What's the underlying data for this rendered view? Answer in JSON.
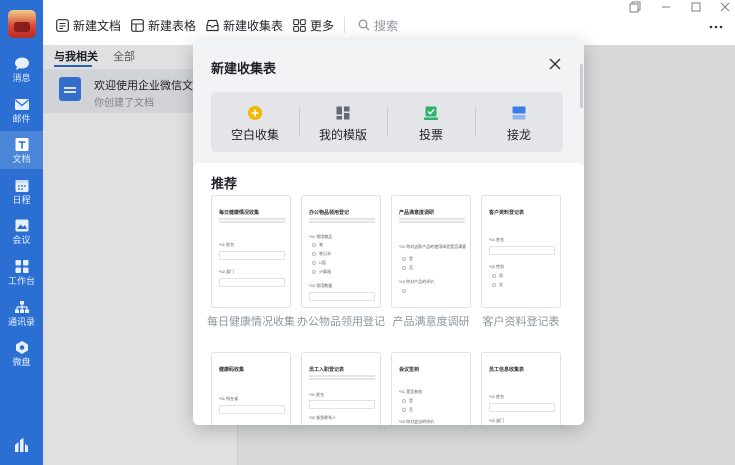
{
  "sidebar": {
    "items": [
      {
        "label": "消息"
      },
      {
        "label": "邮件"
      },
      {
        "label": "文档"
      },
      {
        "label": "日程"
      },
      {
        "label": "会议"
      },
      {
        "label": "工作台"
      },
      {
        "label": "通讯录"
      },
      {
        "label": "微盘"
      }
    ],
    "accent": "#2a6fd1"
  },
  "toolbar": {
    "new_doc": "新建文档",
    "new_sheet": "新建表格",
    "new_form": "新建收集表",
    "more": "更多",
    "search_placeholder": "搜索"
  },
  "list": {
    "tab_related": "与我相关",
    "tab_all": "全部",
    "doc_title": "欢迎使用企业微信文档",
    "doc_sub": "你创建了文档"
  },
  "modal": {
    "title": "新建收集表",
    "options": [
      {
        "label": "空白收集",
        "icon": "plus-circle-icon",
        "color": "#f5b800"
      },
      {
        "label": "我的模版",
        "icon": "grid-icon",
        "color": "#646a73"
      },
      {
        "label": "投票",
        "icon": "vote-icon",
        "color": "#2fb36b"
      },
      {
        "label": "接龙",
        "icon": "relay-icon",
        "color": "#3b7ee6"
      }
    ],
    "recommend_title": "推荐",
    "templates": [
      {
        "label": "每日健康情况收集",
        "card_title": "每日健康情况收集",
        "q1": "*01 姓名",
        "q2": "*02 部门"
      },
      {
        "label": "办公物品领用登记",
        "card_title": "办公物品领用登记",
        "q1": "*01 领用物品",
        "opts": [
          "笔",
          "笔记本",
          "U盘",
          "计算器"
        ],
        "q2": "*02 领用数量"
      },
      {
        "label": "产品满意度调研",
        "card_title": "产品满意度调研",
        "q1": "*01 你对这款产品的使用体验是否满意",
        "opts": [
          "是",
          "否"
        ],
        "q2": "*02 你对产品的评价"
      },
      {
        "label": "客户资料登记表",
        "card_title": "客户资料登记表",
        "q1": "*01 姓名",
        "q2": "*02 性别",
        "opts": [
          "男",
          "女"
        ]
      },
      {
        "card_title": "健康码收集",
        "q1": "*01 所在省"
      },
      {
        "card_title": "员工入职登记表",
        "q1": "*01 姓名",
        "q2": "*02 紧急联系人"
      },
      {
        "card_title": "会议签到",
        "q1": "*01 是否参加",
        "opts": [
          "是",
          "否"
        ],
        "q2": "*02 你对会议的评价"
      },
      {
        "card_title": "员工信息收集表",
        "q1": "*01 姓名",
        "q2": "*02 部门"
      }
    ]
  }
}
